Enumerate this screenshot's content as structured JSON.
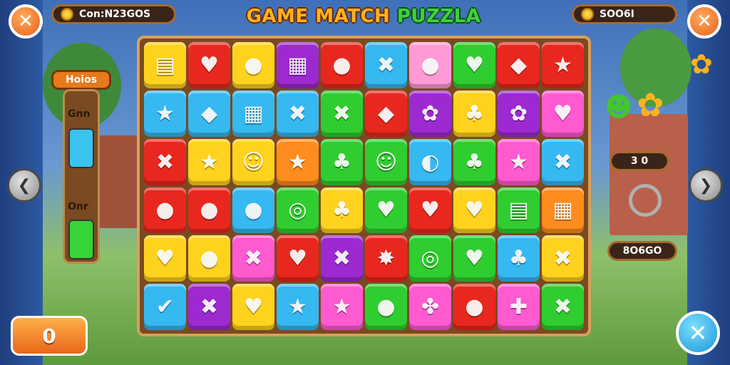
{
  "title": {
    "part1": "GAME MATCH ",
    "part2": "PUZZLA"
  },
  "top_left_counter": {
    "text": "Con:N23GOS",
    "icon": "trophy-icon"
  },
  "top_right_counter": {
    "text": "SOO6I",
    "icon": "coin-icon"
  },
  "left_tag": "Hoios",
  "left_panel": {
    "top_label": "Gnn",
    "bottom_label": "Onr",
    "top_fill_color": "#39c4f0",
    "bottom_fill_color": "#36d436"
  },
  "right_counter_mid": "3 0",
  "right_counter_bottom": "8O6GO",
  "bottom_left_button": "0",
  "colors": {
    "accent_orange": "#e8661a",
    "accent_blue": "#1896d8",
    "board_wood": "#7a4a22"
  },
  "grid": [
    [
      {
        "c": "#ffd21e",
        "i": "▤"
      },
      {
        "c": "#e8281e",
        "i": "♥"
      },
      {
        "c": "#ffd21e",
        "i": "●"
      },
      {
        "c": "#9c2ad0",
        "i": "▦"
      },
      {
        "c": "#e8281e",
        "i": "●"
      },
      {
        "c": "#36b8f0",
        "i": "✖"
      },
      {
        "c": "#ff9ad6",
        "i": "●"
      },
      {
        "c": "#2fcd2f",
        "i": "♥"
      },
      {
        "c": "#e8281e",
        "i": "◆"
      },
      {
        "c": "#e8281e",
        "i": "★"
      }
    ],
    [
      {
        "c": "#36b8f0",
        "i": "★"
      },
      {
        "c": "#36b8f0",
        "i": "◆"
      },
      {
        "c": "#36b8f0",
        "i": "▦"
      },
      {
        "c": "#36b8f0",
        "i": "✖"
      },
      {
        "c": "#2fcd2f",
        "i": "✖"
      },
      {
        "c": "#e8281e",
        "i": "◆"
      },
      {
        "c": "#9c2ad0",
        "i": "✿"
      },
      {
        "c": "#ffd21e",
        "i": "♣"
      },
      {
        "c": "#9c2ad0",
        "i": "✿"
      },
      {
        "c": "#ff5ad0",
        "i": "♥"
      }
    ],
    [
      {
        "c": "#e8281e",
        "i": "✖"
      },
      {
        "c": "#ffd21e",
        "i": "★"
      },
      {
        "c": "#ffd21e",
        "i": "☺"
      },
      {
        "c": "#ff8c1e",
        "i": "★"
      },
      {
        "c": "#2fcd2f",
        "i": "♣"
      },
      {
        "c": "#2fcd2f",
        "i": "☺"
      },
      {
        "c": "#36b8f0",
        "i": "◐"
      },
      {
        "c": "#2fcd2f",
        "i": "♣"
      },
      {
        "c": "#ff5ad0",
        "i": "★"
      },
      {
        "c": "#36b8f0",
        "i": "✖"
      }
    ],
    [
      {
        "c": "#e8281e",
        "i": "●"
      },
      {
        "c": "#e8281e",
        "i": "●"
      },
      {
        "c": "#36b8f0",
        "i": "●"
      },
      {
        "c": "#2fcd2f",
        "i": "◎"
      },
      {
        "c": "#ffd21e",
        "i": "♣"
      },
      {
        "c": "#2fcd2f",
        "i": "♥"
      },
      {
        "c": "#e8281e",
        "i": "♥"
      },
      {
        "c": "#ffd21e",
        "i": "♥"
      },
      {
        "c": "#2fcd2f",
        "i": "▤"
      },
      {
        "c": "#ff8c1e",
        "i": "▦"
      }
    ],
    [
      {
        "c": "#ffd21e",
        "i": "♥"
      },
      {
        "c": "#ffd21e",
        "i": "●"
      },
      {
        "c": "#ff5ad0",
        "i": "✖"
      },
      {
        "c": "#e8281e",
        "i": "♥"
      },
      {
        "c": "#9c2ad0",
        "i": "✖"
      },
      {
        "c": "#e8281e",
        "i": "✸"
      },
      {
        "c": "#2fcd2f",
        "i": "◎"
      },
      {
        "c": "#2fcd2f",
        "i": "♥"
      },
      {
        "c": "#36b8f0",
        "i": "♣"
      },
      {
        "c": "#ffd21e",
        "i": "✖"
      }
    ],
    [
      {
        "c": "#36b8f0",
        "i": "✔"
      },
      {
        "c": "#9c2ad0",
        "i": "✖"
      },
      {
        "c": "#ffd21e",
        "i": "♥"
      },
      {
        "c": "#36b8f0",
        "i": "★"
      },
      {
        "c": "#ff5ad0",
        "i": "★"
      },
      {
        "c": "#2fcd2f",
        "i": "●"
      },
      {
        "c": "#ff5ad0",
        "i": "✤"
      },
      {
        "c": "#e8281e",
        "i": "●"
      },
      {
        "c": "#ff5ad0",
        "i": "✚"
      },
      {
        "c": "#2fcd2f",
        "i": "✖"
      }
    ]
  ]
}
